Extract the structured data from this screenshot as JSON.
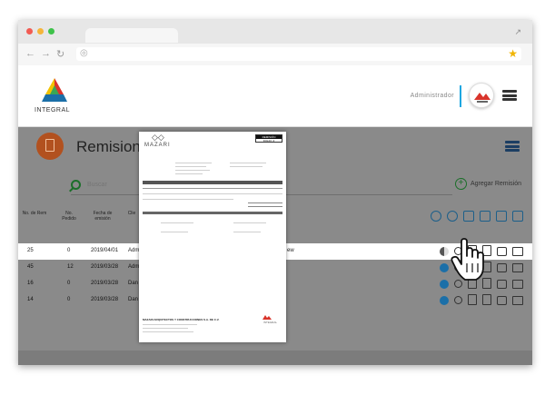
{
  "app": {
    "brand": "INTEGRAL",
    "user": "Administrador",
    "page_title": "Remisiones"
  },
  "search": {
    "placeholder": "Buscar"
  },
  "toolbar": {
    "add_label": "Agregar Remisión"
  },
  "table": {
    "headers": [
      "No. de Rem",
      "No. Pedido",
      "Fecha de emisión",
      "Clie"
    ],
    "rows": [
      {
        "rem": "25",
        "pedido": "0",
        "fecha": "2019/04/01",
        "cliente": "Adm",
        "extra": "ew",
        "status_color": "#9e9e9e",
        "highlight": true
      },
      {
        "rem": "45",
        "pedido": "12",
        "fecha": "2019/03/28",
        "cliente": "Adm",
        "extra": "",
        "status_color": "#1b6fa8",
        "highlight": false
      },
      {
        "rem": "16",
        "pedido": "0",
        "fecha": "2019/03/28",
        "cliente": "Dan",
        "extra": "",
        "status_color": "#1b6fa8",
        "highlight": false
      },
      {
        "rem": "14",
        "pedido": "0",
        "fecha": "2019/03/28",
        "cliente": "Dan",
        "extra": "",
        "status_color": "#1b6fa8",
        "highlight": false
      }
    ]
  },
  "preview": {
    "brand": "MAZARI",
    "badge_top": "REMISIÓN",
    "badge_bottom": "FOLIO: 2",
    "company": "MAZARI ARQUITECTOS Y CONSTRUCCIONES S.A. DE C.V.",
    "integral": "INTEGRAL"
  },
  "colors": {
    "accent_blue": "#1ea7e1",
    "navy": "#1c3e63",
    "green": "#1c6f2a",
    "orange": "#b2511f",
    "red": "#d9342b"
  }
}
